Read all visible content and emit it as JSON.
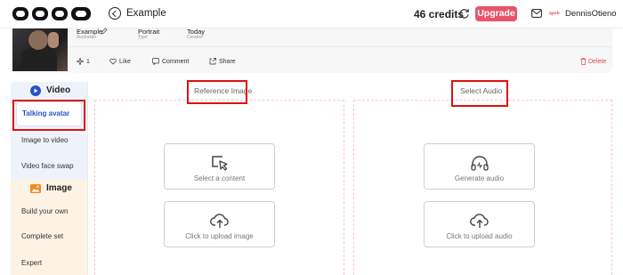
{
  "header": {
    "logo_text": "qpob",
    "title": "Example",
    "credits": "46 credits",
    "upgrade_label": "Upgrade",
    "mini_logo_text": "qpob",
    "username": "DennisOtieno"
  },
  "video_card": {
    "meta": [
      {
        "value": "Example",
        "label": "Australian"
      },
      {
        "value": "Portrait",
        "label": "Type"
      },
      {
        "value": "Today",
        "label": "Created"
      }
    ],
    "actions": {
      "count": "1",
      "like": "Like",
      "comment": "Comment",
      "share": "Share",
      "delete": "Delete"
    }
  },
  "sidebar": {
    "video_heading": "Video",
    "video_items": [
      "Talking avatar",
      "Image to video",
      "Video face swap"
    ],
    "image_heading": "Image",
    "image_items": [
      "Build your own",
      "Complete set",
      "Expert"
    ]
  },
  "reference_panel": {
    "label": "Reference Image",
    "buttons": [
      "Select a content",
      "Click to upload image"
    ]
  },
  "audio_panel": {
    "label": "Select Audio",
    "buttons": [
      "Generate audio",
      "Click to upload audio"
    ]
  },
  "colors": {
    "accent": "#e8546a",
    "active_blue": "#2754c9",
    "highlight": "#e01010",
    "delete": "#e04848"
  },
  "icons": [
    "back-icon",
    "refresh-icon",
    "mail-icon",
    "edit-icon",
    "sparkle-icon",
    "heart-icon",
    "comment-icon",
    "share-icon",
    "trash-icon",
    "video-play-icon",
    "image-icon",
    "cursor-select-icon",
    "cloud-upload-icon",
    "headphones-icon"
  ]
}
